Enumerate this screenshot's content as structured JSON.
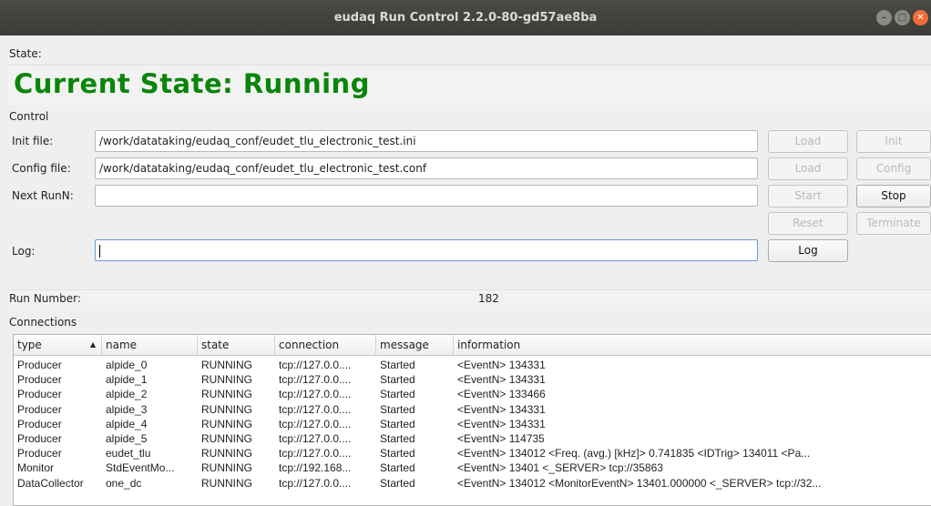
{
  "window": {
    "title": "eudaq Run Control 2.2.0-80-gd57ae8ba"
  },
  "state": {
    "label": "State:",
    "current": "Current State: Running"
  },
  "control": {
    "section_label": "Control",
    "init_label": "Init file:",
    "init_value": "/work/datataking/eudaq_conf/eudet_tlu_electronic_test.ini",
    "config_label": "Config file:",
    "config_value": "/work/datataking/eudaq_conf/eudet_tlu_electronic_test.conf",
    "nextrun_label": "Next RunN:",
    "nextrun_value": "",
    "log_label": "Log:",
    "log_value": "",
    "buttons": {
      "load_init": "Load",
      "init": "Init",
      "load_config": "Load",
      "config": "Config",
      "start": "Start",
      "stop": "Stop",
      "reset": "Reset",
      "terminate": "Terminate",
      "log": "Log"
    }
  },
  "run": {
    "label": "Run Number:",
    "value": "182"
  },
  "connections": {
    "section_label": "Connections",
    "columns": [
      "type",
      "name",
      "state",
      "connection",
      "message",
      "information"
    ],
    "rows": [
      [
        "Producer",
        "alpide_0",
        "RUNNING",
        "tcp://127.0.0....",
        "Started",
        "<EventN> 134331"
      ],
      [
        "Producer",
        "alpide_1",
        "RUNNING",
        "tcp://127.0.0....",
        "Started",
        "<EventN> 134331"
      ],
      [
        "Producer",
        "alpide_2",
        "RUNNING",
        "tcp://127.0.0....",
        "Started",
        "<EventN> 133466"
      ],
      [
        "Producer",
        "alpide_3",
        "RUNNING",
        "tcp://127.0.0....",
        "Started",
        "<EventN> 134331"
      ],
      [
        "Producer",
        "alpide_4",
        "RUNNING",
        "tcp://127.0.0....",
        "Started",
        "<EventN> 134331"
      ],
      [
        "Producer",
        "alpide_5",
        "RUNNING",
        "tcp://127.0.0....",
        "Started",
        "<EventN> 114735"
      ],
      [
        "Producer",
        "eudet_tlu",
        "RUNNING",
        "tcp://127.0.0....",
        "Started",
        "<EventN> 134012  <Freq. (avg.) [kHz]> 0.741835  <IDTrig> 134011  <Pa..."
      ],
      [
        "Monitor",
        "StdEventMo...",
        "RUNNING",
        "tcp://192.168...",
        "Started",
        "<EventN> 13401  <_SERVER> tcp://35863"
      ],
      [
        "DataCollector",
        "one_dc",
        "RUNNING",
        "tcp://127.0.0....",
        "Started",
        "<EventN> 134012  <MonitorEventN> 13401.000000  <_SERVER> tcp://32..."
      ]
    ]
  }
}
